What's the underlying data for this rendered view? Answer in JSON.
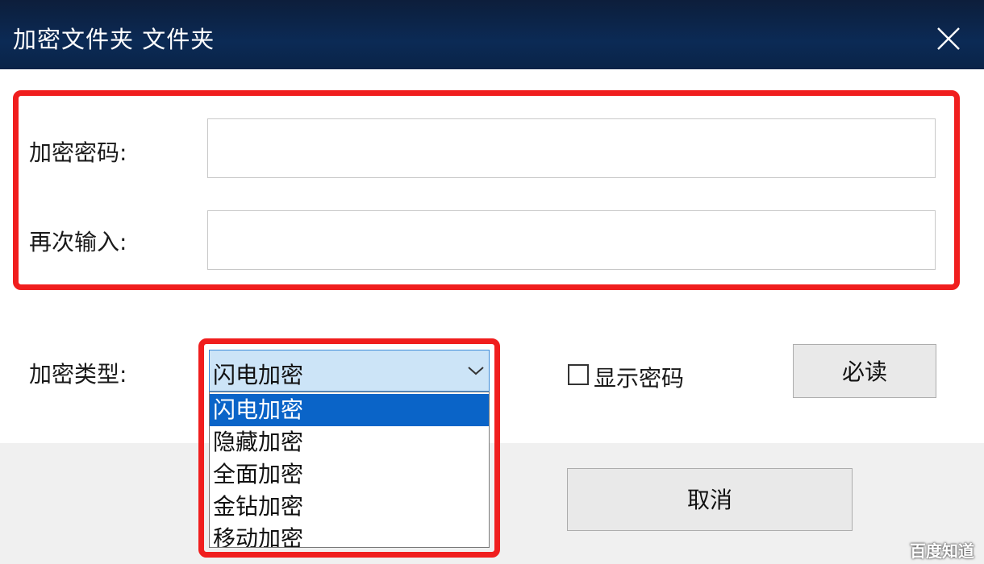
{
  "window": {
    "title": "加密文件夹 文件夹",
    "close_icon": "close-icon"
  },
  "form": {
    "password_label": "加密密码:",
    "password_value": "",
    "confirm_label": "再次输入:",
    "confirm_value": "",
    "type_label": "加密类型:",
    "type_selected": "闪电加密",
    "type_options": [
      "闪电加密",
      "隐藏加密",
      "全面加密",
      "金钻加密",
      "移动加密"
    ],
    "show_password_label": "显示密码",
    "show_password_checked": false
  },
  "buttons": {
    "must_read": "必读",
    "cancel": "取消"
  },
  "watermark": "百度知道",
  "colors": {
    "highlight": "#f01e1e",
    "selected_option": "#0a64c8",
    "titlebar": "#0b2a55"
  }
}
